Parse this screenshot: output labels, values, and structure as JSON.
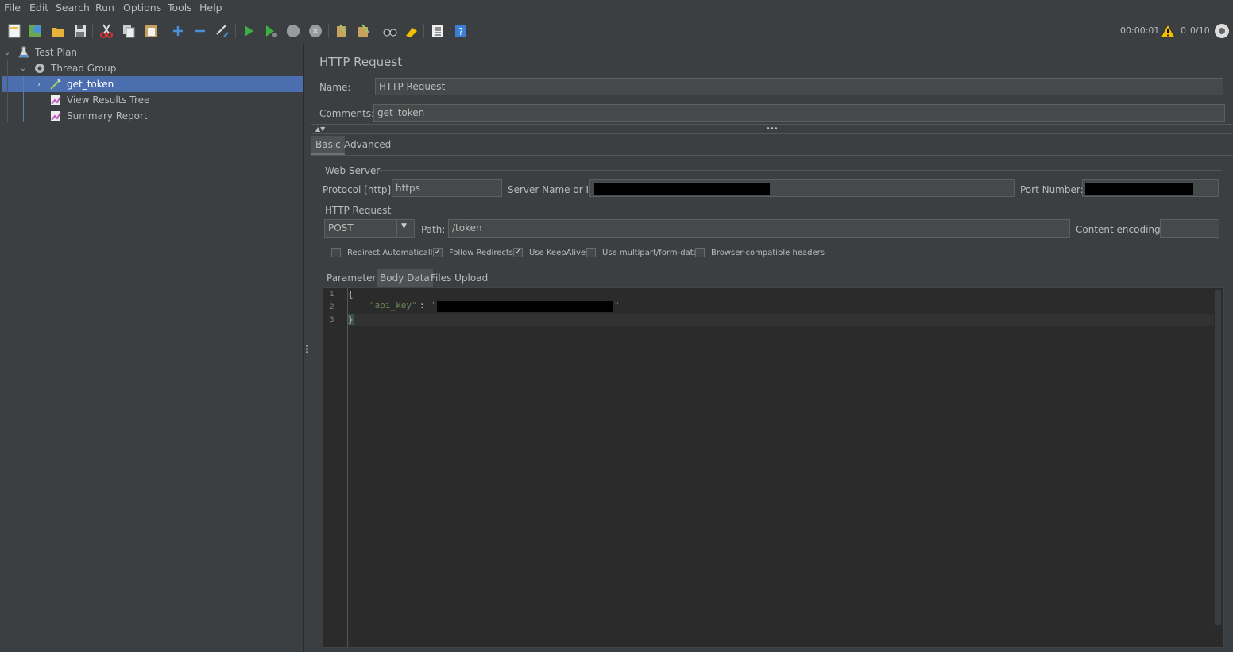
{
  "menu": [
    "File",
    "Edit",
    "Search",
    "Run",
    "Options",
    "Tools",
    "Help"
  ],
  "toolbar": {
    "icons": [
      "new-icon",
      "templates-icon",
      "open-icon",
      "save-icon",
      "cut-icon",
      "copy-icon",
      "paste-icon",
      "expand-icon",
      "collapse-icon",
      "toggle-icon",
      "start-icon",
      "start-no-pause-icon",
      "stop-icon",
      "shutdown-icon",
      "clear-icon",
      "clear-all-icon",
      "search-icon",
      "reset-search-icon",
      "function-helper-icon",
      "help-icon"
    ],
    "elapsed": "00:00:01",
    "warnings": "0",
    "threads": "0/10"
  },
  "tree": {
    "items": [
      {
        "label": "Test Plan"
      },
      {
        "label": "Thread Group"
      },
      {
        "label": "get_token"
      },
      {
        "label": "View Results Tree"
      },
      {
        "label": "Summary Report"
      }
    ]
  },
  "panel": {
    "title": "HTTP Request",
    "name_label": "Name:",
    "name_value": "HTTP Request",
    "comments_label": "Comments:",
    "comments_value": "get_token",
    "tabs": [
      "Basic",
      "Advanced"
    ],
    "web_server": {
      "legend": "Web Server",
      "protocol_label": "Protocol [http]:",
      "protocol_value": "https",
      "server_label": "Server Name or IP:",
      "port_label": "Port Number:"
    },
    "http_request": {
      "legend": "HTTP Request",
      "method": "POST",
      "path_label": "Path:",
      "path_value": "/token",
      "encoding_label": "Content encoding:",
      "options": [
        {
          "label": "Redirect Automatically",
          "checked": false
        },
        {
          "label": "Follow Redirects",
          "checked": true
        },
        {
          "label": "Use KeepAlive",
          "checked": true
        },
        {
          "label": "Use multipart/form-data",
          "checked": false
        },
        {
          "label": "Browser-compatible headers",
          "checked": false
        }
      ]
    },
    "subtabs": [
      "Parameters",
      "Body Data",
      "Files Upload"
    ],
    "body": {
      "line_numbers": [
        "1",
        "2",
        "3"
      ],
      "open_brace": "{",
      "key": "\"api_key\"",
      "colon": ": ",
      "quote_open": "\"",
      "quote_close": "\"",
      "close_brace": "}"
    }
  }
}
